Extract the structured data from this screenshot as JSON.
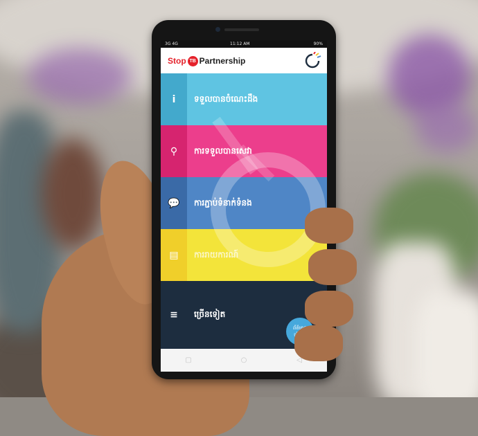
{
  "status_bar": {
    "left": "3G 4G",
    "time": "11:12 AM",
    "right": "90%"
  },
  "header": {
    "logo_stop": "Stop",
    "logo_tb": "TB",
    "logo_partnership": "Partnership"
  },
  "menu": [
    {
      "label": "ទទួលបានចំណេះដឹង",
      "icon": "info-icon",
      "glyph": "i"
    },
    {
      "label": "ការទទួលបានសេវា",
      "icon": "location-icon",
      "glyph": "⚲"
    },
    {
      "label": "ការភ្ជាប់ទំនាក់ទំនង",
      "icon": "chat-icon",
      "glyph": "💬"
    },
    {
      "label": "ការរាយការណ៍",
      "icon": "document-icon",
      "glyph": "▤"
    },
    {
      "label": "ច្រើនទៀត",
      "icon": "menu-icon",
      "glyph": "≡"
    }
  ],
  "fab": {
    "label": "ព័ត៌មាន ចាំបាច់"
  },
  "nav": {
    "recent": "▢",
    "home": "○",
    "back": "◁"
  },
  "colors": {
    "info": "#5fc4e2",
    "service": "#ec3e8c",
    "connect": "#4f86c6",
    "report": "#f3e43a",
    "more": "#1d2d3f"
  }
}
